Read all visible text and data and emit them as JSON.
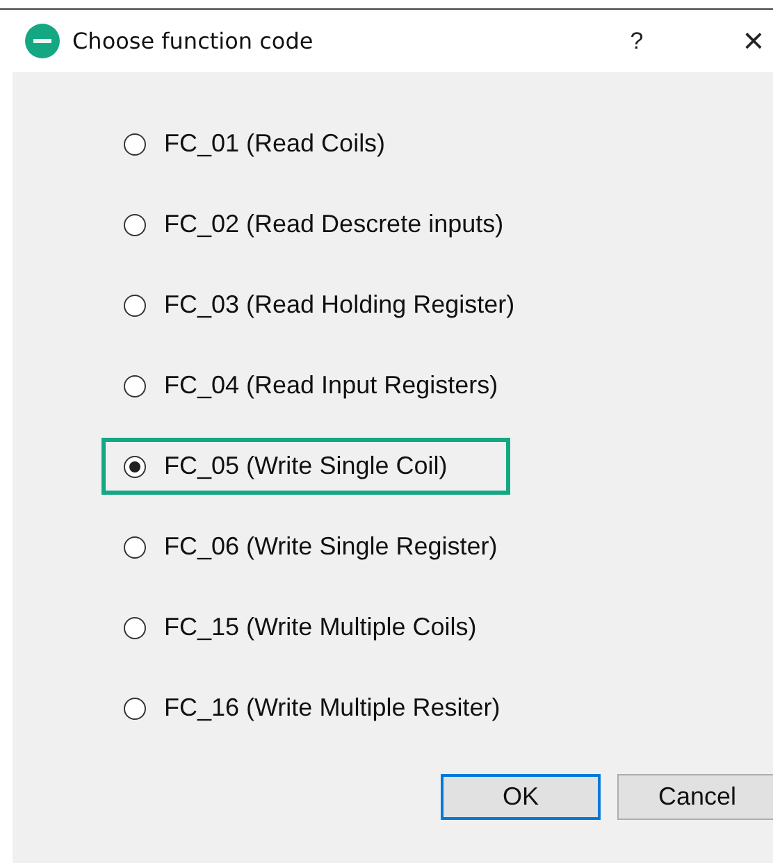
{
  "window": {
    "title": "Choose function code",
    "help": "?",
    "close": "×"
  },
  "options": [
    {
      "label": "FC_01 (Read Coils)",
      "selected": false
    },
    {
      "label": "FC_02 (Read Descrete inputs)",
      "selected": false
    },
    {
      "label": "FC_03 (Read Holding Register)",
      "selected": false
    },
    {
      "label": "FC_04 (Read Input Registers)",
      "selected": false
    },
    {
      "label": "FC_05 (Write Single Coil)",
      "selected": true
    },
    {
      "label": "FC_06 (Write Single Register)",
      "selected": false
    },
    {
      "label": "FC_15 (Write Multiple Coils)",
      "selected": false
    },
    {
      "label": "FC_16 (Write Multiple Resiter)",
      "selected": false
    }
  ],
  "buttons": [
    {
      "label": "OK",
      "default": true
    },
    {
      "label": "Cancel",
      "default": false
    }
  ]
}
